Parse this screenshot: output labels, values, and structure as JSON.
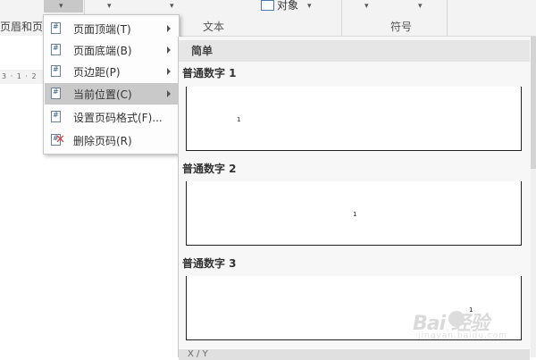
{
  "ribbon": {
    "header_footer_label": "页眉和页脚",
    "text_group_label": "文本",
    "symbols_group_label": "符号",
    "object_label": "对象",
    "dropdown_arrow": "▾"
  },
  "ruler": {
    "text": "3 · 1 · 2"
  },
  "menu": {
    "items": [
      {
        "label": "页面顶端(T)",
        "has_submenu": true
      },
      {
        "label": "页面底端(B)",
        "has_submenu": true
      },
      {
        "label": "页边距(P)",
        "has_submenu": true
      },
      {
        "label": "当前位置(C)",
        "has_submenu": true,
        "active": true
      },
      {
        "label": "设置页码格式(F)...",
        "has_submenu": false
      },
      {
        "label": "删除页码(R)",
        "has_submenu": false
      }
    ]
  },
  "gallery": {
    "category": "简单",
    "items": [
      {
        "label": "普通数字 1",
        "page_number": "1"
      },
      {
        "label": "普通数字 2",
        "page_number": "1"
      },
      {
        "label": "普通数字 3",
        "page_number": "1"
      }
    ],
    "next_category": "X / Y"
  },
  "watermark": {
    "main": "Bai 经验",
    "sub": "jingyan.baidu.com"
  },
  "colors": {
    "ribbon_bg": "#f3f3f3",
    "menu_active_bg": "#c9c9c9",
    "gallery_header_bg": "#e6e6e6",
    "delete_icon": "#d83b3b"
  }
}
